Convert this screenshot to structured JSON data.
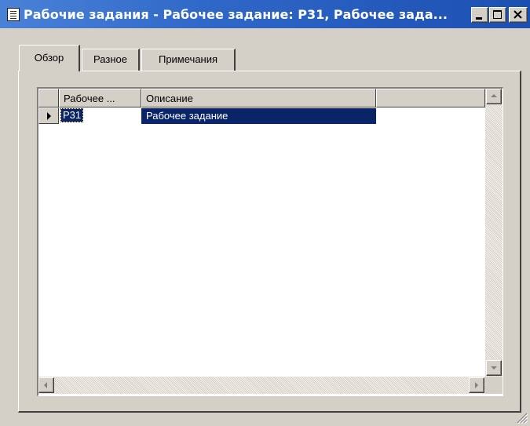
{
  "window": {
    "title": "Рабочие задания - Рабочее задание: Р31, Рабочее зада...",
    "icon": "form-icon"
  },
  "tabs": [
    {
      "label": "Обзор",
      "active": true
    },
    {
      "label": "Разное",
      "active": false
    },
    {
      "label": "Примечания",
      "active": false
    }
  ],
  "grid": {
    "columns": [
      "Рабочее ...",
      "Описание"
    ],
    "rows": [
      {
        "code": "Р31",
        "description": "Рабочее задание",
        "selected": true
      }
    ]
  },
  "colors": {
    "titlebar": "#2f67c8",
    "selection": "#0a246a",
    "face": "#d4d0c8"
  }
}
